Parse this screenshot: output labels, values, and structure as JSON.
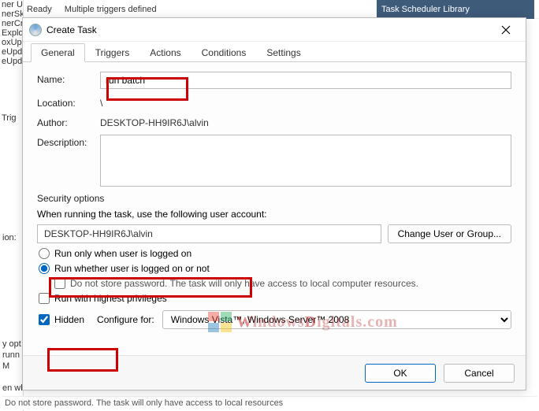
{
  "background": {
    "topbar_status1": "Ready",
    "topbar_status2": "Multiple triggers defined",
    "right_header": "Task Scheduler Library",
    "sidebar_items": [
      "ner Up...",
      "nerSk",
      "nerCr",
      "Explo",
      "oxUp",
      "eUpd",
      "eUpd"
    ],
    "trig_label": "Trig",
    "left2_items": [
      "y opt",
      "runn",
      "M",
      "en wh"
    ],
    "ion_label": "ion:",
    "bottom_note": "Do not store password.  The task will only have access to local resources"
  },
  "dialog": {
    "title": "Create Task",
    "tabs": [
      "General",
      "Triggers",
      "Actions",
      "Conditions",
      "Settings"
    ],
    "fields": {
      "name_label": "Name:",
      "name_value": "run batch",
      "location_label": "Location:",
      "location_value": "\\",
      "author_label": "Author:",
      "author_value": "DESKTOP-HH9IR6J\\alvin",
      "description_label": "Description:"
    },
    "security": {
      "header": "Security options",
      "run_as_text": "When running the task, use the following user account:",
      "user_account": "DESKTOP-HH9IR6J\\alvin",
      "change_user_btn": "Change User or Group...",
      "radio_logged_on": "Run only when user is logged on",
      "radio_whether": "Run whether user is logged on or not",
      "no_store_pw": "Do not store password.  The task will only have access to local computer resources.",
      "highest_priv": "Run with highest privileges"
    },
    "bottom": {
      "hidden_label": "Hidden",
      "configure_label": "Configure for:",
      "configure_value": "Windows Vista™, Windows Server™ 2008"
    },
    "buttons": {
      "ok": "OK",
      "cancel": "Cancel"
    }
  },
  "watermark": "WindowsDigitals.com"
}
